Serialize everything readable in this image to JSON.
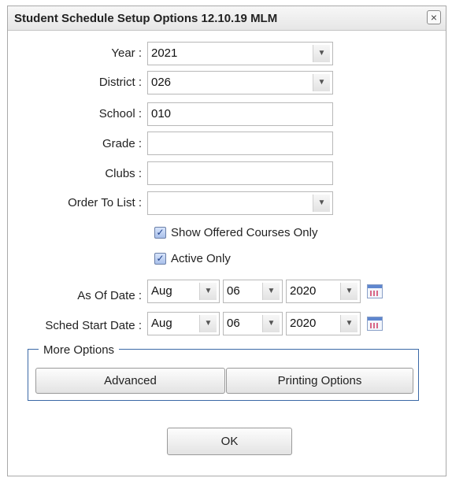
{
  "dialog": {
    "title": "Student Schedule Setup Options 12.10.19 MLM",
    "close_glyph": "×"
  },
  "fields": {
    "year": {
      "label": "Year :",
      "value": "2021"
    },
    "district": {
      "label": "District :",
      "value": "026"
    },
    "school": {
      "label": "School :",
      "value": "010"
    },
    "grade": {
      "label": "Grade :",
      "value": ""
    },
    "clubs": {
      "label": "Clubs :",
      "value": ""
    },
    "order_to_list": {
      "label": "Order To List :",
      "value": ""
    }
  },
  "checkboxes": {
    "show_offered": {
      "label": "Show Offered Courses Only",
      "checked": true
    },
    "active_only": {
      "label": "Active Only",
      "checked": true
    }
  },
  "as_of_date": {
    "label": "As Of Date :",
    "month": "Aug",
    "day": "06",
    "year": "2020"
  },
  "sched_start_date": {
    "label": "Sched Start Date :",
    "month": "Aug",
    "day": "06",
    "year": "2020"
  },
  "more_options": {
    "legend": "More Options",
    "advanced_label": "Advanced",
    "printing_label": "Printing Options"
  },
  "ok_label": "OK",
  "icons": {
    "dropdown": "chevron-down-icon",
    "calendar": "calendar-icon",
    "check": "checkmark-icon",
    "close": "close-icon"
  },
  "colors": {
    "fieldset_border": "#3b69a6",
    "checkbox_fill": "#a9c0ea"
  }
}
